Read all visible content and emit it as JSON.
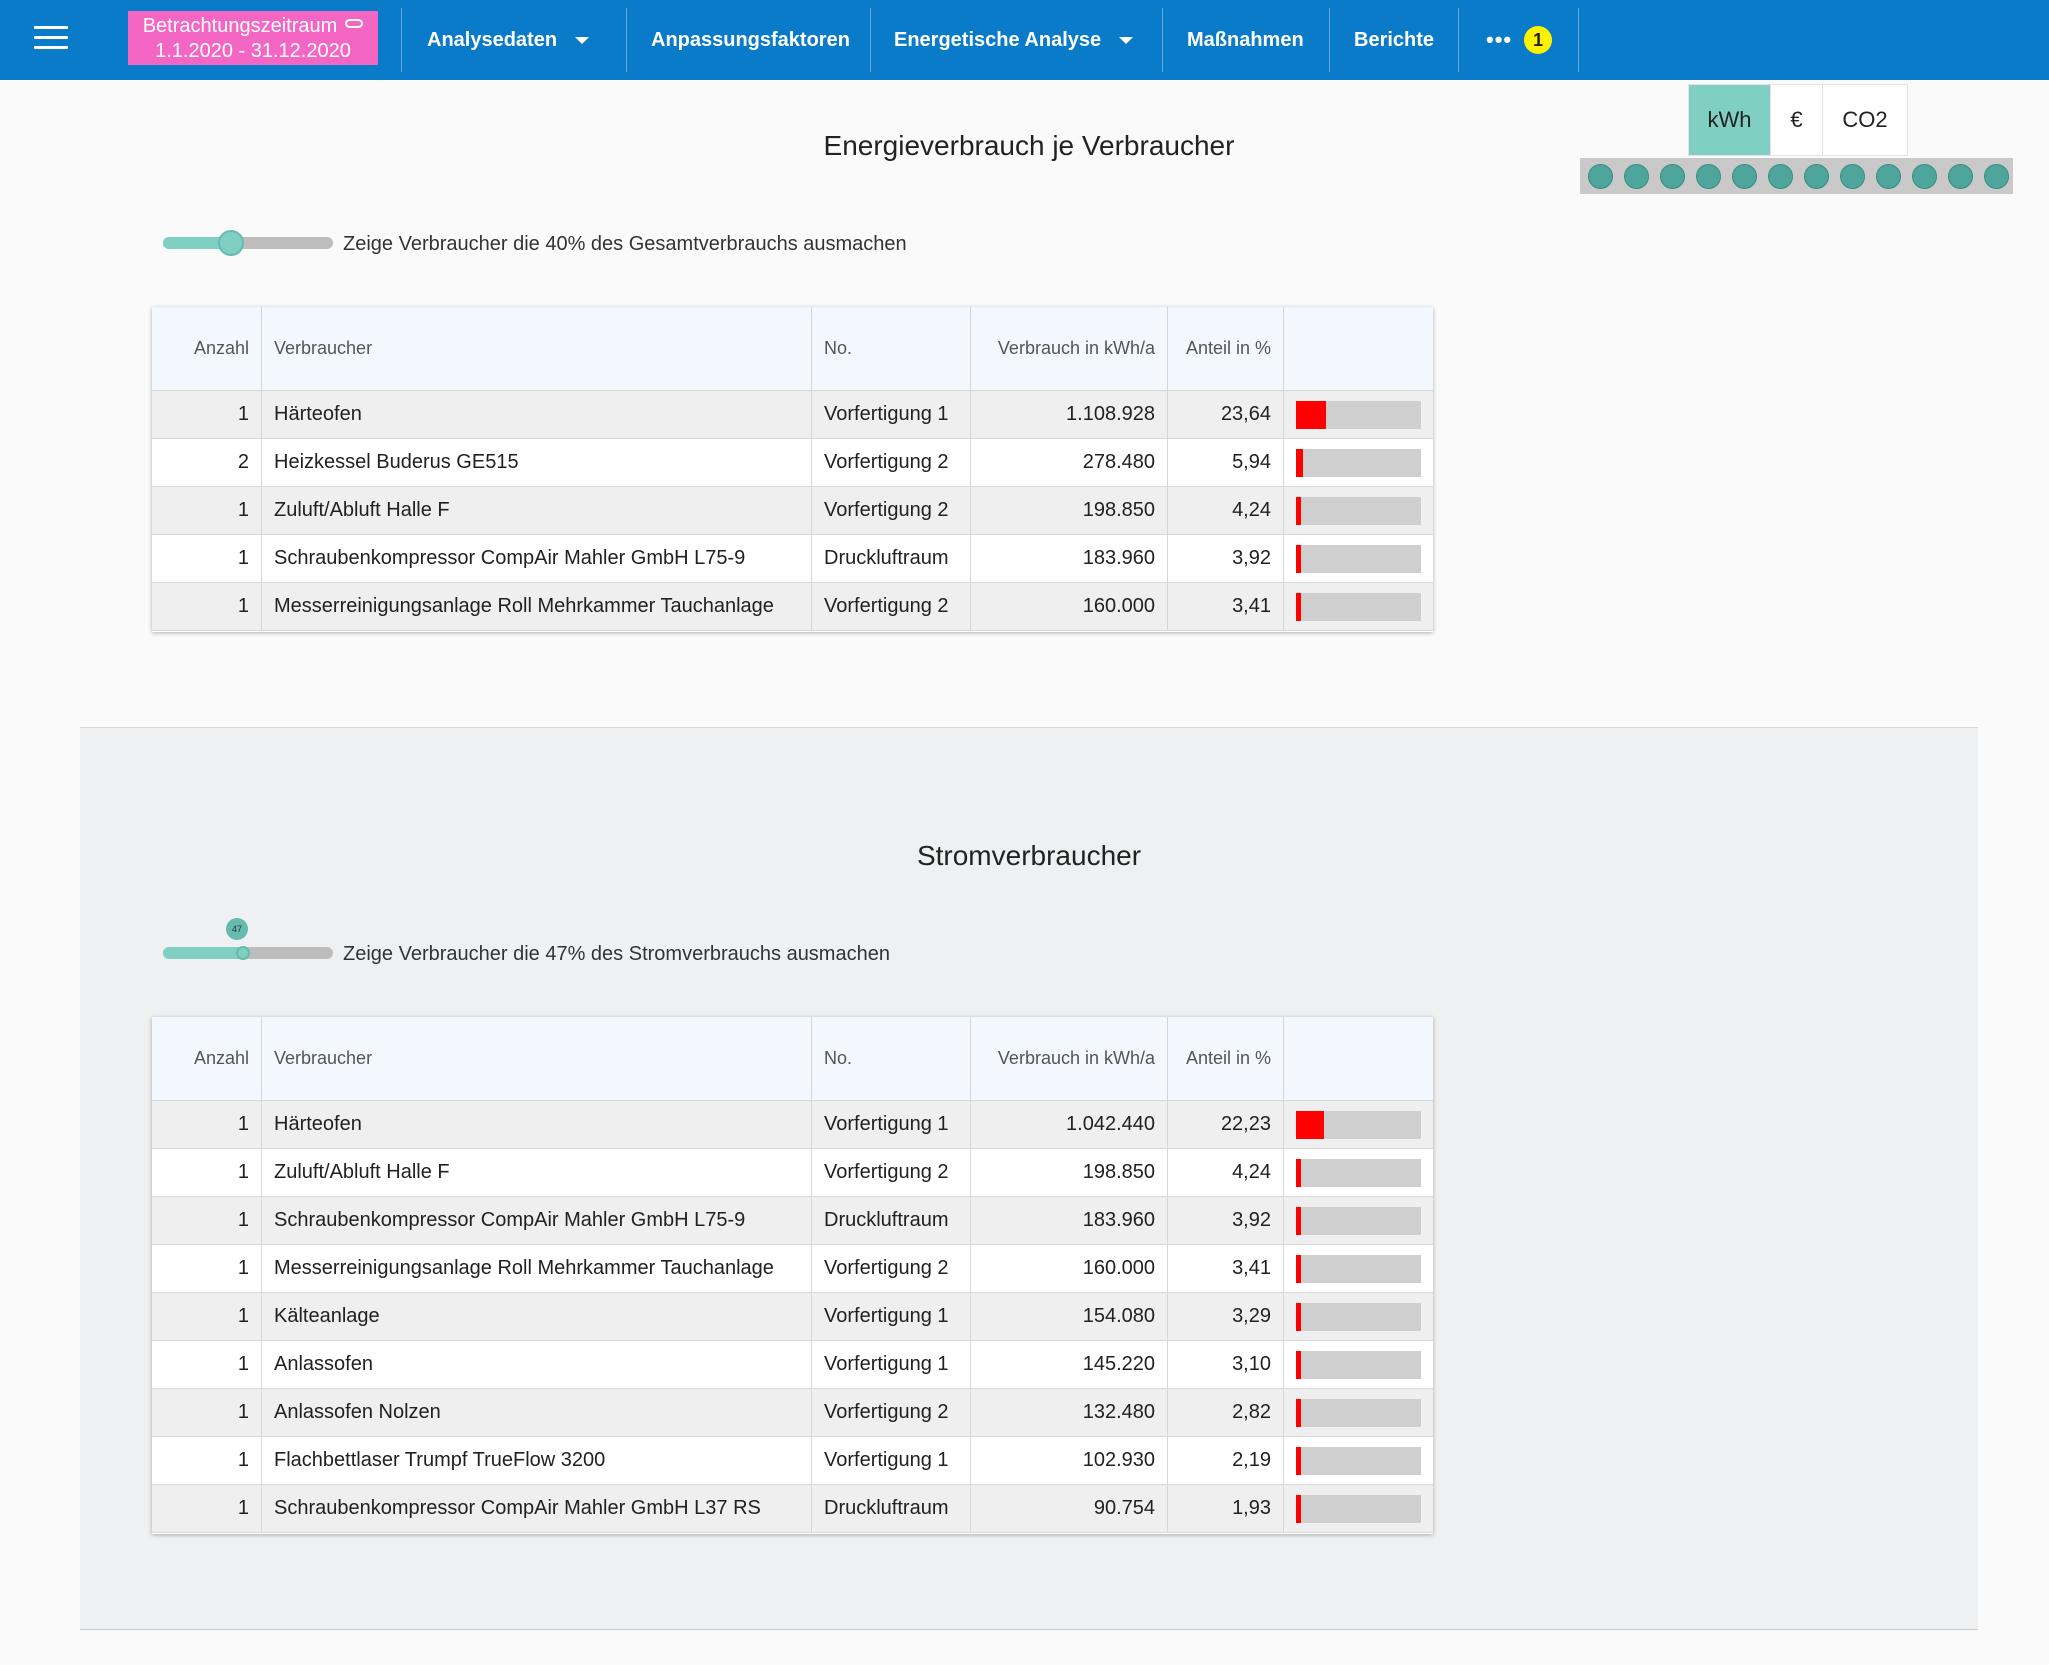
{
  "topbar": {
    "period_title": "Betrachtungszeitraum",
    "period_range": "1.1.2020 - 31.12.2020",
    "nav": [
      {
        "label": "Analysedaten",
        "dropdown": true
      },
      {
        "label": "Anpassungsfaktoren",
        "dropdown": false
      },
      {
        "label": "Energetische Analyse",
        "dropdown": true
      },
      {
        "label": "Maßnahmen",
        "dropdown": false
      },
      {
        "label": "Berichte",
        "dropdown": false
      }
    ],
    "more_label": "•••",
    "badge_count": "1"
  },
  "units": {
    "options": [
      "kWh",
      "€",
      "CO2"
    ],
    "selected": "kWh"
  },
  "colors": {
    "topbar": "#0a7bc9",
    "period": "#f466c4",
    "accent": "#7fcfc2",
    "bar_fill": "#ff0000",
    "badge": "#fff200"
  },
  "energy": {
    "title": "Energieverbrauch je Verbraucher",
    "slider_label": "Zeige Verbraucher die 40% des Gesamtverbrauchs ausmachen",
    "slider_value": 40,
    "headers": [
      "Anzahl",
      "Verbraucher",
      "No.",
      "Verbrauch in kWh/a",
      "Anteil in %",
      ""
    ],
    "rows": [
      {
        "anzahl": "1",
        "verbraucher": "Härteofen",
        "no": "Vorfertigung 1",
        "verbrauch": "1.108.928",
        "anteil": "23,64",
        "share": 23.64
      },
      {
        "anzahl": "2",
        "verbraucher": "Heizkessel Buderus GE515",
        "no": "Vorfertigung 2",
        "verbrauch": "278.480",
        "anteil": "5,94",
        "share": 5.94
      },
      {
        "anzahl": "1",
        "verbraucher": "Zuluft/Abluft Halle F",
        "no": "Vorfertigung 2",
        "verbrauch": "198.850",
        "anteil": "4,24",
        "share": 4.24
      },
      {
        "anzahl": "1",
        "verbraucher": "Schraubenkompressor CompAir Mahler GmbH L75-9",
        "no": "Druckluftraum",
        "verbrauch": "183.960",
        "anteil": "3,92",
        "share": 3.92
      },
      {
        "anzahl": "1",
        "verbraucher": "Messerreinigungsanlage Roll Mehrkammer Tauchanlage",
        "no": "Vorfertigung 2",
        "verbrauch": "160.000",
        "anteil": "3,41",
        "share": 3.41
      }
    ]
  },
  "strom": {
    "title": "Stromverbraucher",
    "slider_label": "Zeige Verbraucher die 47% des Stromverbrauchs ausmachen",
    "slider_value": 47,
    "slider_bubble": "47",
    "headers": [
      "Anzahl",
      "Verbraucher",
      "No.",
      "Verbrauch in kWh/a",
      "Anteil in %",
      ""
    ],
    "rows": [
      {
        "anzahl": "1",
        "verbraucher": "Härteofen",
        "no": "Vorfertigung 1",
        "verbrauch": "1.042.440",
        "anteil": "22,23",
        "share": 22.23
      },
      {
        "anzahl": "1",
        "verbraucher": "Zuluft/Abluft Halle F",
        "no": "Vorfertigung 2",
        "verbrauch": "198.850",
        "anteil": "4,24",
        "share": 4.24
      },
      {
        "anzahl": "1",
        "verbraucher": "Schraubenkompressor CompAir Mahler GmbH L75-9",
        "no": "Druckluftraum",
        "verbrauch": "183.960",
        "anteil": "3,92",
        "share": 3.92
      },
      {
        "anzahl": "1",
        "verbraucher": "Messerreinigungsanlage Roll Mehrkammer Tauchanlage",
        "no": "Vorfertigung 2",
        "verbrauch": "160.000",
        "anteil": "3,41",
        "share": 3.41
      },
      {
        "anzahl": "1",
        "verbraucher": "Kälteanlage",
        "no": "Vorfertigung 1",
        "verbrauch": "154.080",
        "anteil": "3,29",
        "share": 3.29
      },
      {
        "anzahl": "1",
        "verbraucher": "Anlassofen",
        "no": "Vorfertigung 1",
        "verbrauch": "145.220",
        "anteil": "3,10",
        "share": 3.1
      },
      {
        "anzahl": "1",
        "verbraucher": "Anlassofen Nolzen",
        "no": "Vorfertigung 2",
        "verbrauch": "132.480",
        "anteil": "2,82",
        "share": 2.82
      },
      {
        "anzahl": "1",
        "verbraucher": "Flachbettlaser Trumpf TrueFlow 3200",
        "no": "Vorfertigung 1",
        "verbrauch": "102.930",
        "anteil": "2,19",
        "share": 2.19
      },
      {
        "anzahl": "1",
        "verbraucher": "Schraubenkompressor CompAir Mahler GmbH L37 RS",
        "no": "Druckluftraum",
        "verbrauch": "90.754",
        "anteil": "1,93",
        "share": 1.93
      }
    ]
  }
}
